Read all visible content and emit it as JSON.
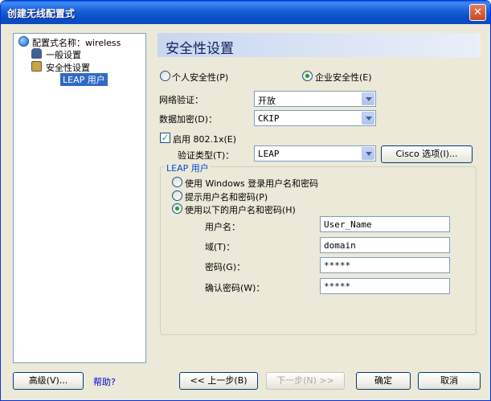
{
  "window": {
    "title": "创建无线配置式",
    "close_glyph": "✕"
  },
  "tree": {
    "root": "配置式名称：wireless",
    "items": [
      "一般设置",
      "安全性设置"
    ],
    "selected": "LEAP 用户"
  },
  "header": {
    "title": "安全性设置"
  },
  "security_mode": {
    "personal": "个人安全性(P)",
    "enterprise": "企业安全性(E)",
    "selected": "enterprise"
  },
  "network_auth": {
    "label": "网络验证：",
    "value": "开放"
  },
  "data_encryption": {
    "label": "数据加密(D)：",
    "value": "CKIP"
  },
  "enable_8021x": {
    "label": "启用 802.1x(E)",
    "checked": true
  },
  "auth_type": {
    "label": "验证类型(T)：",
    "value": "LEAP"
  },
  "cisco_options_button": "Cisco 选项(I)...",
  "leap_group": {
    "legend": "LEAP 用户",
    "options": [
      "使用 Windows 登录用户名和密码",
      "提示用户名和密码(P)",
      "使用以下的用户名和密码(H)"
    ],
    "selected_index": 2,
    "fields": {
      "username": {
        "label": "用户名：",
        "value": "User_Name"
      },
      "domain": {
        "label": "域(T)：",
        "value": "domain"
      },
      "password": {
        "label": "密码(G)：",
        "value": "*****"
      },
      "confirm_password": {
        "label": "确认密码(W)：",
        "value": "*****"
      }
    }
  },
  "footer": {
    "advanced": "高级(V)...",
    "help": "帮助?",
    "back": "<< 上一步(B)",
    "next": "下一步(N) >>",
    "ok": "确定",
    "cancel": "取消"
  },
  "colors": {
    "titlebar": "#0a4fc8",
    "selection": "#316ac5",
    "dialog_bg": "#ece9d8",
    "radio_dot": "#21a121"
  }
}
